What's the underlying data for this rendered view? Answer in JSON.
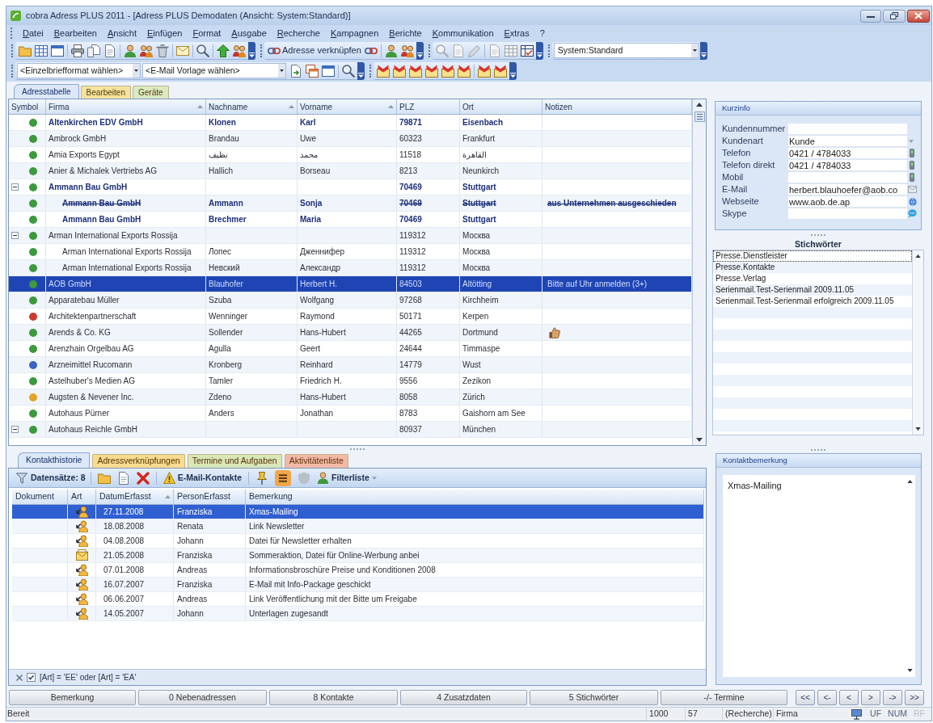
{
  "window": {
    "title": "cobra Adress PLUS 2011 - [Adress PLUS Demodaten (Ansicht: System:Standard)]"
  },
  "menu": [
    "Datei",
    "Bearbeiten",
    "Ansicht",
    "Einfügen",
    "Format",
    "Ausgabe",
    "Recherche",
    "Kampagnen",
    "Berichte",
    "Kommunikation",
    "Extras",
    "?"
  ],
  "toolbar": {
    "link_button": "Adresse verknüpfen",
    "view_select": "System:Standard"
  },
  "format_toolbar": {
    "letter_format": "<Einzelbriefformat wählen>",
    "email_template": "<E-Mail Vorlage wählen>"
  },
  "main_tabs": [
    {
      "label": "Adresstabelle",
      "selected": true,
      "color": "#dce8f8"
    },
    {
      "label": "Bearbeiten",
      "selected": false,
      "color": "#f5e29c"
    },
    {
      "label": "Geräte",
      "selected": false,
      "color": "#dbe9c2"
    }
  ],
  "address_table": {
    "columns": [
      {
        "label": "Symbol",
        "sorted": false
      },
      {
        "label": "Firma",
        "sorted": true
      },
      {
        "label": "Nachname",
        "sorted": true
      },
      {
        "label": "Vorname",
        "sorted": true
      },
      {
        "label": "PLZ",
        "sorted": false
      },
      {
        "label": "Ort",
        "sorted": false
      },
      {
        "label": "Notizen",
        "sorted": false
      }
    ],
    "rows": [
      {
        "color": "#3c9a3c",
        "firma": "Altenkirchen EDV GmbH",
        "nachname": "Klonen",
        "vorname": "Karl",
        "plz": "79871",
        "ort": "Eisenbach",
        "bold": true,
        "struck": false,
        "selected": false,
        "note_icon": false
      },
      {
        "color": "#3c9a3c",
        "firma": "Ambrock GmbH",
        "nachname": "Brandau",
        "vorname": "Uwe",
        "plz": "60323",
        "ort": "Frankfurt",
        "bold": false,
        "struck": false,
        "selected": false,
        "note_icon": false
      },
      {
        "color": "#3c9a3c",
        "firma": "Amia Exports Egypt",
        "nachname": "نظيف",
        "vorname": "محمد",
        "plz": "11518",
        "ort": "القاهرة",
        "bold": false,
        "struck": false,
        "selected": false,
        "note_icon": false
      },
      {
        "color": "#3c9a3c",
        "firma": "Anier & Michalek Vertriebs AG",
        "nachname": "Hallich",
        "vorname": "Borseau",
        "plz": "8213",
        "ort": "Neunkirch",
        "bold": false,
        "struck": false,
        "selected": false,
        "note_icon": false
      },
      {
        "color": "#3c9a3c",
        "firma": "Ammann Bau GmbH",
        "plz": "70469",
        "ort": "Stuttgart",
        "bold": true,
        "struck": false,
        "selected": false,
        "note_icon": false,
        "expanded": true,
        "children": [
          {
            "color": "#3c9a3c",
            "firma": "Ammann Bau GmbH",
            "nachname": "Ammann",
            "vorname": "Sonja",
            "plz": "70469",
            "ort": "Stuttgart",
            "notizen": "aus Unternehmen ausgeschieden",
            "bold": true,
            "struck": true,
            "selected": false,
            "note_icon": false
          },
          {
            "color": "#3c9a3c",
            "firma": "Ammann Bau GmbH",
            "nachname": "Brechmer",
            "vorname": "Maria",
            "plz": "70469",
            "ort": "Stuttgart",
            "bold": true,
            "struck": false,
            "selected": false,
            "note_icon": false
          }
        ]
      },
      {
        "color": "#3c9a3c",
        "firma": "Arman International Exports Rossija",
        "plz": "119312",
        "ort": "Москва",
        "bold": false,
        "struck": false,
        "selected": false,
        "note_icon": false,
        "expanded": true,
        "children": [
          {
            "color": "#3c9a3c",
            "firma": "Arman International Exports Rossija",
            "nachname": "Лопес",
            "vorname": "Дженнифер",
            "plz": "119312",
            "ort": "Москва",
            "bold": false,
            "struck": false,
            "selected": false,
            "note_icon": false
          },
          {
            "color": "#3c9a3c",
            "firma": "Arman International Exports Rossija",
            "nachname": "Невский",
            "vorname": "Александр",
            "plz": "119312",
            "ort": "Москва",
            "bold": false,
            "struck": false,
            "selected": false,
            "note_icon": false
          }
        ]
      },
      {
        "color": "#3c9a3c",
        "firma": "AOB GmbH",
        "nachname": "Blauhofer",
        "vorname": "Herbert H.",
        "plz": "84503",
        "ort": "Altötting",
        "notizen": "Bitte auf Uhr anmelden (3+)",
        "bold": false,
        "struck": false,
        "selected": true,
        "note_icon": false
      },
      {
        "color": "#3c9a3c",
        "firma": "Apparatebau Müller",
        "nachname": "Szuba",
        "vorname": "Wolfgang",
        "plz": "97268",
        "ort": "Kirchheim",
        "bold": false,
        "struck": false,
        "selected": false,
        "note_icon": false
      },
      {
        "color": "#cc3a2e",
        "firma": "Architektenpartnerschaft",
        "nachname": "Wenninger",
        "vorname": "Raymond",
        "plz": "50171",
        "ort": "Kerpen",
        "bold": false,
        "struck": false,
        "selected": false,
        "note_icon": false
      },
      {
        "color": "#3c9a3c",
        "firma": "Arends & Co. KG",
        "nachname": "Sollender",
        "vorname": "Hans-Hubert",
        "plz": "44265",
        "ort": "Dortmund",
        "bold": false,
        "struck": false,
        "selected": false,
        "note_icon": true
      },
      {
        "color": "#3c9a3c",
        "firma": "Arenzhain Orgelbau AG",
        "nachname": "Agulla",
        "vorname": "Geert",
        "plz": "24644",
        "ort": "Timmaspe",
        "bold": false,
        "struck": false,
        "selected": false,
        "note_icon": false
      },
      {
        "color": "#3b63c4",
        "firma": "Arzneimittel Rucomann",
        "nachname": "Kronberg",
        "vorname": "Reinhard",
        "plz": "14779",
        "ort": "Wust",
        "bold": false,
        "struck": false,
        "selected": false,
        "note_icon": false
      },
      {
        "color": "#3c9a3c",
        "firma": "Astelhuber's Medien AG",
        "nachname": "Tamler",
        "vorname": "Friedrich H.",
        "plz": "9556",
        "ort": "Zezikon",
        "bold": false,
        "struck": false,
        "selected": false,
        "note_icon": false
      },
      {
        "color": "#e2a52a",
        "firma": "Augsten & Nevener Inc.",
        "nachname": "Zdeno",
        "vorname": "Hans-Hubert",
        "plz": "8058",
        "ort": "Zürich",
        "bold": false,
        "struck": false,
        "selected": false,
        "note_icon": false
      },
      {
        "color": "#3c9a3c",
        "firma": "Autohaus Pürner",
        "nachname": "Anders",
        "vorname": "Jonathan",
        "plz": "8783",
        "ort": "Gaishorn am See",
        "bold": false,
        "struck": false,
        "selected": false,
        "note_icon": false
      },
      {
        "color": "#3c9a3c",
        "firma": "Autohaus Reichle GmbH",
        "plz": "80937",
        "ort": "München",
        "bold": false,
        "struck": false,
        "selected": false,
        "note_icon": false,
        "expanded": true
      }
    ]
  },
  "kurzinfo": {
    "title": "Kurzinfo",
    "fields": [
      {
        "label": "Kundennummer",
        "kind": "text"
      },
      {
        "label": "Kundenart",
        "value": "Kunde",
        "kind": "select"
      },
      {
        "label": "Telefon",
        "value": "0421 / 4784033",
        "kind": "phone"
      },
      {
        "label": "Telefon direkt",
        "value": "0421 / 4784033",
        "kind": "phone"
      },
      {
        "label": "Mobil",
        "kind": "phone"
      },
      {
        "label": "E-Mail",
        "value": "herbert.blauhoefer@aob.co",
        "kind": "email"
      },
      {
        "label": "Webseite",
        "value": "www.aob.de.ap",
        "kind": "web"
      },
      {
        "label": "Skype",
        "kind": "chat"
      }
    ]
  },
  "stichwoerter": {
    "title": "Stichwörter",
    "items": [
      {
        "label": "Presse.Dienstleister",
        "focused": true
      },
      {
        "label": "Presse.Kontakte",
        "focused": false
      },
      {
        "label": "Presse.Verlag",
        "focused": false
      },
      {
        "label": "Serienmail.Test-Serienmail 2009.11.05",
        "focused": false
      },
      {
        "label": "Serienmail.Test-Serienmail erfolgreich 2009.11.05",
        "focused": false
      }
    ]
  },
  "bottom_tabs": [
    {
      "label": "Kontakthistorie",
      "selected": true,
      "color": "#dce8f8"
    },
    {
      "label": "Adressverknüpfungen",
      "selected": false,
      "color": "#f7dc8e"
    },
    {
      "label": "Termine und Aufgaben",
      "selected": false,
      "color": "#d9e6b8"
    },
    {
      "label": "Aktivitätenliste",
      "selected": false,
      "color": "#f3b9a6"
    }
  ],
  "contact_toolbar": {
    "record_count": "Datensätze: 8",
    "email_contacts": "E-Mail-Kontakte",
    "filter_list": "Filterliste"
  },
  "contact_table": {
    "columns": [
      {
        "label": "Dokument",
        "sorted": false
      },
      {
        "label": "Art",
        "sorted": false
      },
      {
        "label": "DatumErfasst",
        "sorted": true
      },
      {
        "label": "PersonErfasst",
        "sorted": false
      },
      {
        "label": "Bemerkung",
        "sorted": false
      }
    ],
    "rows": [
      {
        "kind": "action",
        "date": "27.11.2008",
        "person": "Franziska",
        "remark": "Xmas-Mailing",
        "selected": true
      },
      {
        "kind": "action",
        "date": "18.08.2008",
        "person": "Renata",
        "remark": "Link Newsletter",
        "selected": false
      },
      {
        "kind": "action",
        "date": "04.08.2008",
        "person": "Johann",
        "remark": "Datei für Newsletter erhalten",
        "selected": false
      },
      {
        "kind": "letter",
        "date": "21.05.2008",
        "person": "Franziska",
        "remark": "Sommeraktion, Datei für Online-Werbung anbei",
        "selected": false
      },
      {
        "kind": "action",
        "date": "07.01.2008",
        "person": "Andreas",
        "remark": "Informationsbroschüre Preise und Konditionen 2008",
        "selected": false
      },
      {
        "kind": "action",
        "date": "16.07.2007",
        "person": "Franziska",
        "remark": "E-Mail mit Info-Package geschickt",
        "selected": false
      },
      {
        "kind": "action",
        "date": "06.06.2007",
        "person": "Andreas",
        "remark": "Link Veröffentlichung mit der Bitte um Freigabe",
        "selected": false
      },
      {
        "kind": "action",
        "date": "14.05.2007",
        "person": "Johann",
        "remark": "Unterlagen zugesandt",
        "selected": false
      }
    ]
  },
  "filter": {
    "checked": true,
    "expression": "[Art] = 'EE' oder [Art] = 'EA'"
  },
  "kontaktbemerkung": {
    "title": "Kontaktbemerkung",
    "text": "Xmas-Mailing"
  },
  "record_buttons": [
    "Bemerkung",
    "0 Nebenadressen",
    "8 Kontakte",
    "4 Zusatzdaten",
    "5 Stichwörter",
    "-/- Termine"
  ],
  "navigation_buttons": [
    "<<",
    "<-",
    "<",
    ">",
    "->",
    ">>"
  ],
  "status_bar": {
    "message": "Bereit",
    "fields": [
      "1000",
      "57",
      "(Recherche)",
      "Firma"
    ],
    "indicators": [
      {
        "label": "UF",
        "active": true
      },
      {
        "label": "NUM",
        "active": true
      },
      {
        "label": "RF",
        "active": false
      }
    ]
  }
}
